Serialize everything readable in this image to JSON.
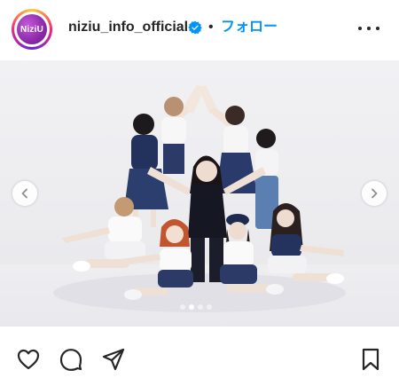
{
  "header": {
    "avatar_text": "NiziU",
    "username": "niziu_info_official",
    "separator": "•",
    "follow_label": "フォロー"
  },
  "icons": {
    "verified": "verified-badge-icon",
    "more": "more-options-icon",
    "like": "heart-icon",
    "comment": "comment-icon",
    "share": "paper-plane-icon",
    "save": "bookmark-icon",
    "prev": "chevron-left-icon",
    "next": "chevron-right-icon"
  },
  "colors": {
    "accent": "#0095f6",
    "text": "#262626"
  },
  "carousel": {
    "slide_count": 4,
    "active_index": 1
  },
  "media": {
    "alt": ""
  }
}
